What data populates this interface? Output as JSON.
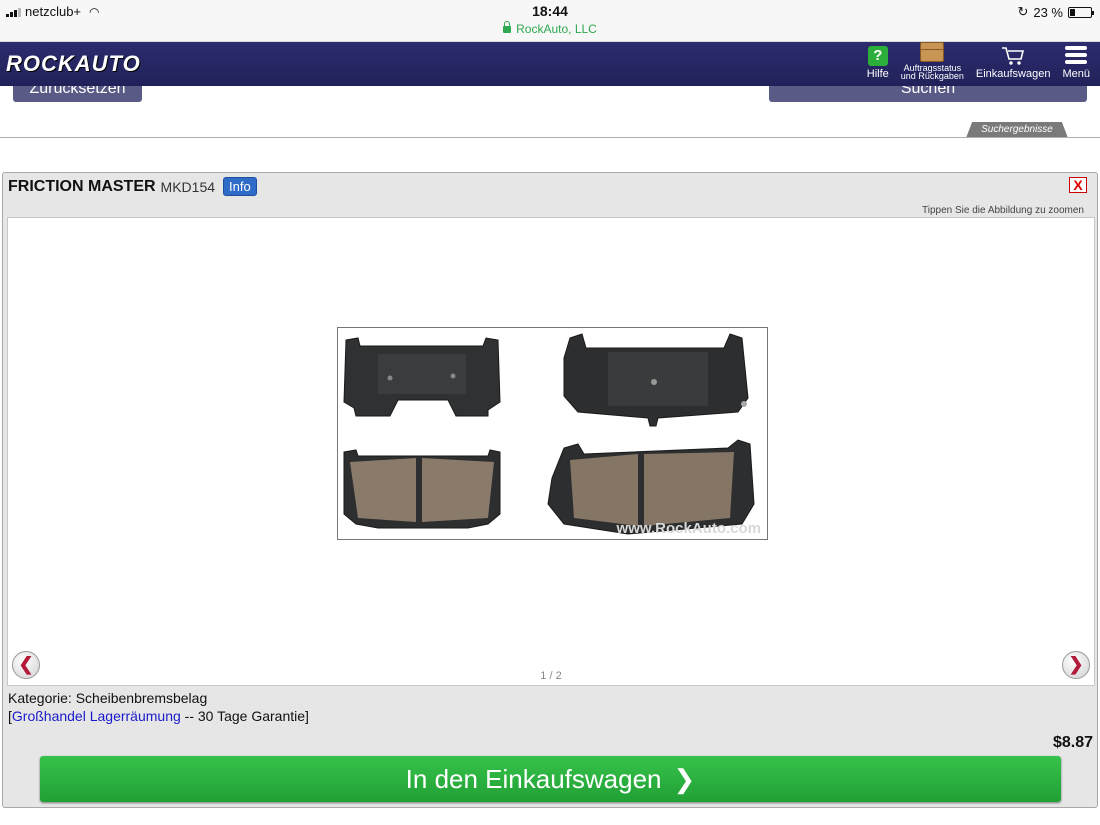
{
  "status_bar": {
    "carrier": "netzclub+",
    "time": "18:44",
    "url": "RockAuto, LLC",
    "battery": "23 %",
    "battery_fraction": 0.23
  },
  "header": {
    "logo": "ROCKAUTO",
    "nav": {
      "help": "Hilfe",
      "orders_line1": "Auftragsstatus",
      "orders_line2": "und Rückgaben",
      "cart": "Einkaufswagen",
      "menu": "Menü"
    }
  },
  "buttons": {
    "reset": "Zurücksetzen",
    "search": "Suchen"
  },
  "results_tab": "Suchergebnisse",
  "product": {
    "brand": "FRICTION MASTER",
    "part_number": "MKD154",
    "info_label": "Info",
    "close_label": "X",
    "zoom_hint": "Tippen Sie die Abbildung zu zoomen",
    "watermark": "www.RockAuto.com",
    "pager": "1 / 2",
    "category": "Kategorie: Scheibenbremsbelag",
    "clearance_bracket_open": "[",
    "clearance_link": "Großhandel Lagerräumung",
    "clearance_suffix": " -- 30 Tage Garantie]",
    "price": "$8.87",
    "add_to_cart": "In den Einkaufswagen"
  },
  "colors": {
    "header_bg": "#21215a",
    "cart_button": "#2bb23f",
    "link": "#1a1acc",
    "url_green": "#2fa84f"
  }
}
